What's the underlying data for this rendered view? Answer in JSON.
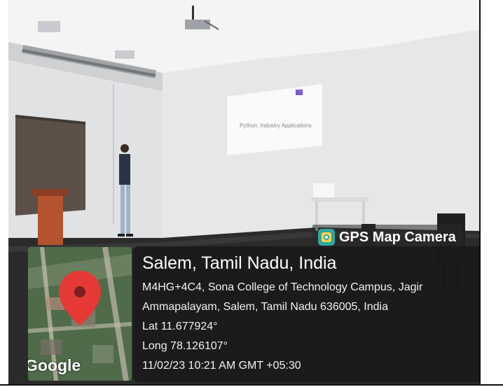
{
  "photo": {
    "slide_title": "Python: Industry Applications",
    "scene_description": "Lecture hall with a projected slide, a presenter standing near a lectern, and a projector on the ceiling."
  },
  "badge": {
    "title": "GPS Map Camera",
    "icon": "camera-location-icon",
    "icon_color": "#2fa6a0"
  },
  "location": {
    "place": "Salem, Tamil Nadu, India",
    "address_line_1": "M4HG+4C4, Sona College of Technology Campus, Jagir",
    "address_line_2": "Ammapalayam, Salem, Tamil Nadu 636005, India",
    "lat": "Lat 11.677924°",
    "long": "Long 78.126107°",
    "datetime": "11/02/23 10:21 AM GMT +05:30"
  },
  "map": {
    "provider": "Google",
    "pin_color": "#e53935"
  }
}
